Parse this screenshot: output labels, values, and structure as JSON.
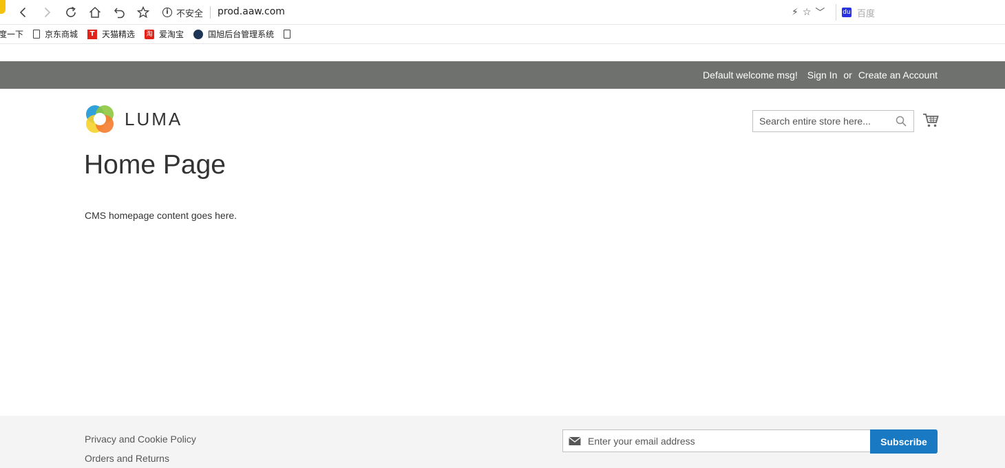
{
  "browser": {
    "security_label": "不安全",
    "url": "prod.aaw.com",
    "search_engine_label": "百度",
    "bookmarks": [
      {
        "label": "度一下",
        "icon": "partial-bookmark"
      },
      {
        "label": "京东商城",
        "icon": "page-icon"
      },
      {
        "label": "天猫精选",
        "icon": "tmall-icon"
      },
      {
        "label": "爱淘宝",
        "icon": "taobao-icon"
      },
      {
        "label": "国旭后台管理系统",
        "icon": "gx-icon"
      },
      {
        "label": "",
        "icon": "page-icon"
      }
    ]
  },
  "panel": {
    "welcome": "Default welcome msg!",
    "sign_in": "Sign In",
    "or": "or",
    "create_account": "Create an Account"
  },
  "header": {
    "logo_text": "LUMA",
    "search_placeholder": "Search entire store here...",
    "cart_icon": "cart-icon"
  },
  "main": {
    "title": "Home Page",
    "content": "CMS homepage content goes here."
  },
  "footer": {
    "links": [
      "Privacy and Cookie Policy",
      "Orders and Returns"
    ],
    "newsletter_placeholder": "Enter your email address",
    "subscribe_label": "Subscribe"
  },
  "colors": {
    "panel_bg": "#6e716e",
    "footer_bg": "#f4f4f4",
    "subscribe_bg": "#1979c3"
  }
}
